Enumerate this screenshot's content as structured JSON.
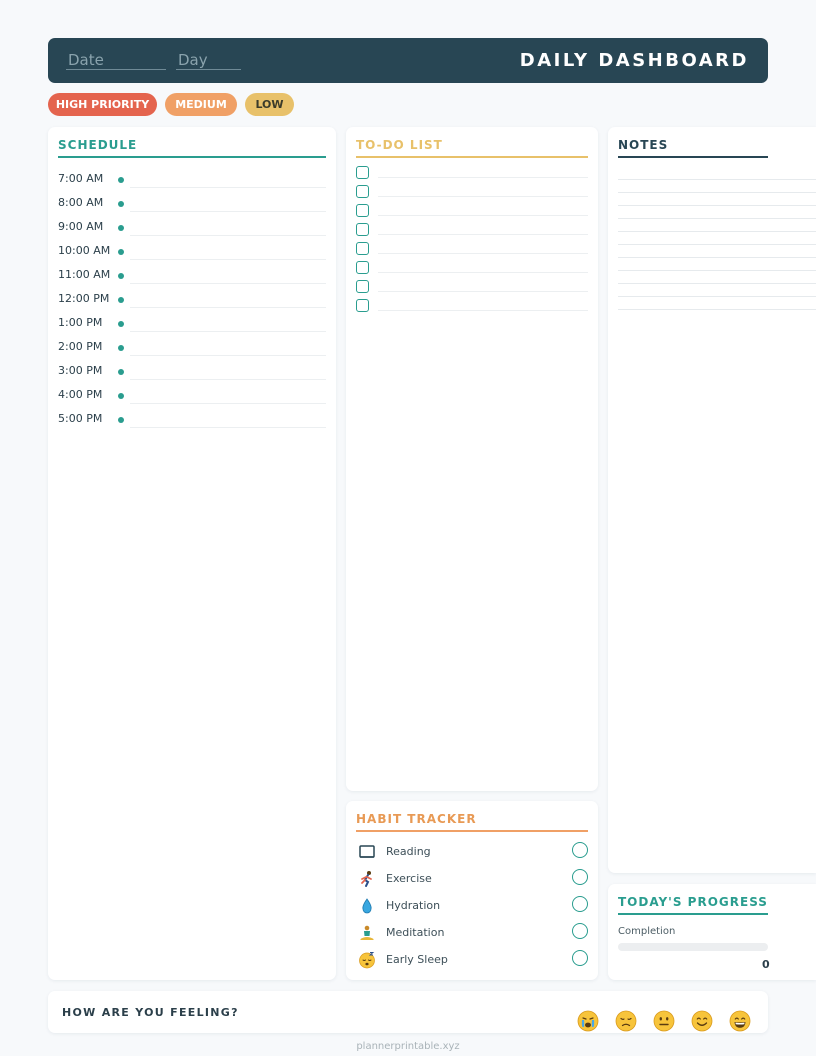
{
  "header": {
    "date_placeholder": "Date",
    "day_placeholder": "Day",
    "title": "DAILY DASHBOARD"
  },
  "priorities": [
    {
      "label": "HIGH PRIORITY",
      "color": "#e4644e"
    },
    {
      "label": "MEDIUM",
      "color": "#f0a066"
    },
    {
      "label": "LOW",
      "color": "#e8c16a"
    }
  ],
  "schedule": {
    "title": "SCHEDULE",
    "times": [
      "7:00 AM",
      "8:00 AM",
      "9:00 AM",
      "10:00 AM",
      "11:00 AM",
      "12:00 PM",
      "1:00 PM",
      "2:00 PM",
      "3:00 PM",
      "4:00 PM",
      "5:00 PM"
    ]
  },
  "todo": {
    "title": "TO-DO LIST",
    "item_count": 8
  },
  "notes": {
    "title": "NOTES"
  },
  "habits": {
    "title": "HABIT TRACKER",
    "items": [
      {
        "label": "Reading",
        "icon": "book-icon"
      },
      {
        "label": "Exercise",
        "icon": "runner-icon"
      },
      {
        "label": "Hydration",
        "icon": "water-drop-icon"
      },
      {
        "label": "Meditation",
        "icon": "meditation-icon"
      },
      {
        "label": "Early Sleep",
        "icon": "sleep-face-icon"
      }
    ]
  },
  "progress": {
    "title": "TODAY'S PROGRESS",
    "completion_label": "Completion",
    "value_text": "0"
  },
  "mood": {
    "question": "HOW ARE YOU FEELING?",
    "options": [
      "crying-face-icon",
      "sad-face-icon",
      "neutral-face-icon",
      "smiling-face-icon",
      "grinning-face-icon"
    ]
  },
  "footer": {
    "text": "plannerprintable.xyz"
  },
  "colors": {
    "dark": "#284654",
    "teal": "#2a9d8f",
    "yellow": "#e8c16a",
    "orange": "#f0a066"
  }
}
